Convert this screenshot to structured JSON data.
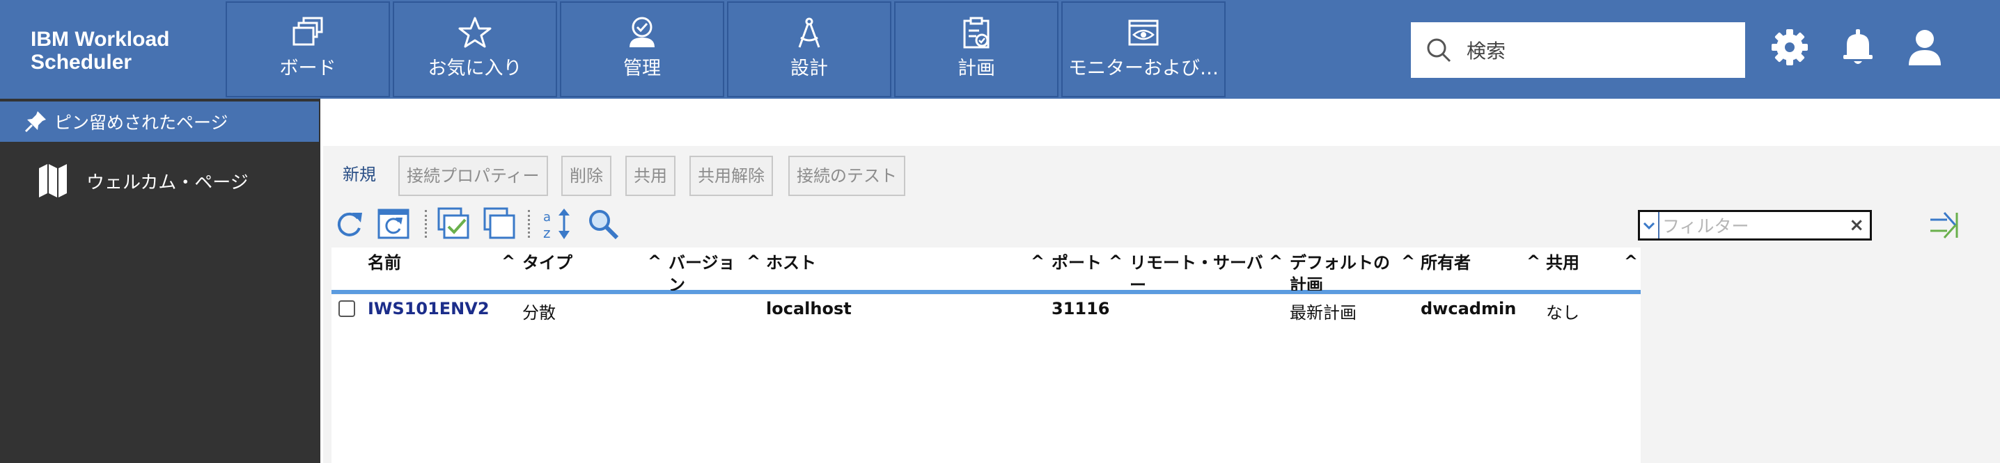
{
  "app": {
    "title_line1": "IBM Workload",
    "title_line2": "Scheduler"
  },
  "nav_tabs": [
    {
      "label": "ボード",
      "icon": "board-icon"
    },
    {
      "label": "お気に入り",
      "icon": "star-icon"
    },
    {
      "label": "管理",
      "icon": "admin-user-check-icon"
    },
    {
      "label": "設計",
      "icon": "compass-design-icon"
    },
    {
      "label": "計画",
      "icon": "clipboard-plan-icon"
    },
    {
      "label": "モニターおよび…",
      "icon": "monitor-eye-icon"
    }
  ],
  "search": {
    "placeholder": "検索",
    "value": ""
  },
  "header_icons": [
    "gear-icon",
    "bell-icon",
    "user-icon"
  ],
  "sidebar": {
    "pinned_label": "ピン留めされたページ",
    "items": [
      {
        "label": "ウェルカム・ページ",
        "icon": "map-icon"
      }
    ]
  },
  "actions": {
    "new": "新規",
    "properties": "接続プロパティー",
    "delete": "削除",
    "share": "共用",
    "unshare": "共用解除",
    "test": "接続のテスト"
  },
  "toolbar_icons": [
    "refresh-icon",
    "auto-refresh-icon",
    "select-all-icon",
    "deselect-all-icon",
    "sort-icon",
    "search-icon"
  ],
  "filter": {
    "placeholder": "フィルター",
    "clear": "×"
  },
  "table": {
    "columns": [
      "名前",
      "タイプ",
      "バージョン",
      "ホスト",
      "ポート",
      "リモート・サーバー",
      "デフォルトの計画",
      "所有者",
      "共用"
    ],
    "sort_caret": "^",
    "rows": [
      {
        "name": "IWS101ENV2",
        "type": "分散",
        "version": "",
        "host": "localhost",
        "port": "31116",
        "remote_server": "",
        "default_plan": "最新計画",
        "owner": "dwcadmin",
        "shared": "なし"
      }
    ]
  },
  "colors": {
    "header_bg": "#4772b1",
    "sidebar_bg": "#333333",
    "link": "#1b2d8a",
    "accent_rule": "#5b9bdf"
  }
}
